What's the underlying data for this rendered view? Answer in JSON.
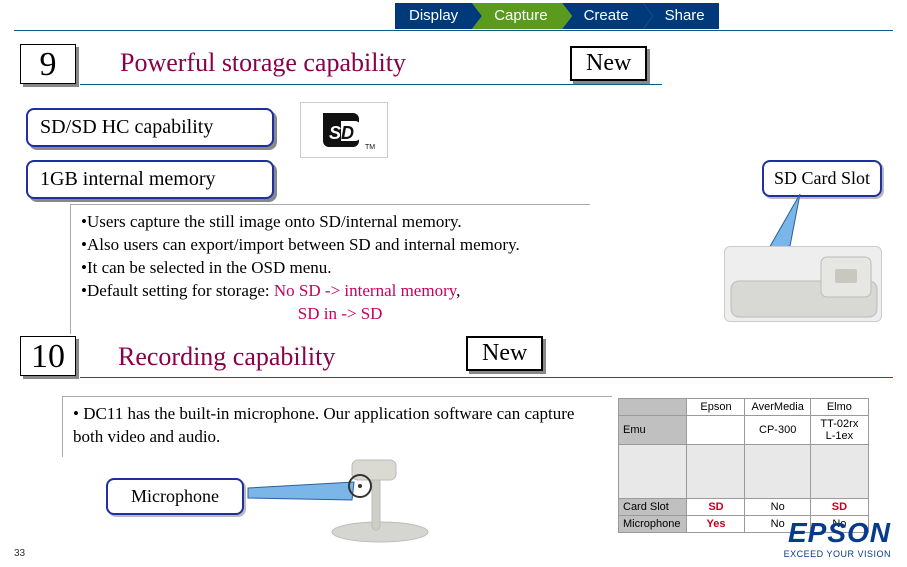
{
  "nav": {
    "items": [
      "Display",
      "Capture",
      "Create",
      "Share"
    ],
    "active_index": 1
  },
  "section9": {
    "number": "9",
    "title": "Powerful storage capability",
    "new_label": "New",
    "sub1": "SD/SD HC capability",
    "sub2": "1GB internal memory",
    "bullets": {
      "b1": "Users capture the still image onto SD/internal memory.",
      "b2": "Also users can export/import between SD and internal memory.",
      "b3": "It can be selected in the OSD menu.",
      "b4_prefix": "Default setting for storage: ",
      "b4_rule1": "No SD -> internal memory",
      "b4_comma": ",",
      "b4_rule2_indent": "                                                   ",
      "b4_rule2": "SD in  -> SD"
    },
    "callout_sd": "SD Card Slot"
  },
  "section10": {
    "number": "10",
    "title": "Recording capability",
    "new_label": "New",
    "bullet": " DC11 has the built-in microphone. Our application software can capture both video and audio.",
    "callout_mic": "Microphone"
  },
  "compare_table": {
    "headers": [
      "",
      "Epson",
      "AverMedia",
      "Elmo"
    ],
    "row_emu": {
      "label": "Emu",
      "c1": "",
      "c2": "CP-300",
      "c3": "TT-02rx\nL-1ex"
    },
    "row_card": {
      "label": "Card Slot",
      "c1": "SD",
      "c2": "No",
      "c3": "SD"
    },
    "row_mic": {
      "label": "Microphone",
      "c1": "Yes",
      "c2": "No",
      "c3": "No"
    }
  },
  "brand": {
    "logo": "EPSON",
    "tagline": "EXCEED YOUR VISION"
  },
  "page_number": "33"
}
